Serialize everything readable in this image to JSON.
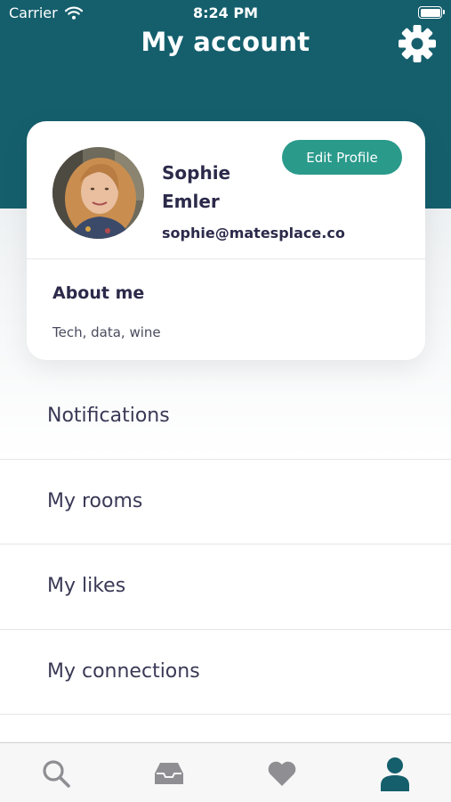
{
  "status_bar": {
    "carrier": "Carrier",
    "time": "8:24 PM"
  },
  "header": {
    "title": "My account",
    "settings_icon": "gear-icon"
  },
  "profile": {
    "first_name": "Sophie",
    "last_name": "Emler",
    "email": "sophie@matesplace.co",
    "edit_button_label": "Edit Profile",
    "about_title": "About me",
    "about_text": "Tech, data, wine"
  },
  "menu": {
    "items": [
      {
        "label": "Notifications"
      },
      {
        "label": "My rooms"
      },
      {
        "label": "My likes"
      },
      {
        "label": "My connections"
      }
    ]
  },
  "tab_bar": {
    "tabs": [
      {
        "icon": "search-icon",
        "active": false
      },
      {
        "icon": "inbox-icon",
        "active": false
      },
      {
        "icon": "heart-icon",
        "active": false
      },
      {
        "icon": "person-icon",
        "active": true
      }
    ]
  },
  "colors": {
    "header": "#155f6d",
    "accent": "#2a9a8b",
    "tab_active": "#155f6d",
    "tab_inactive": "#8e8e93"
  }
}
